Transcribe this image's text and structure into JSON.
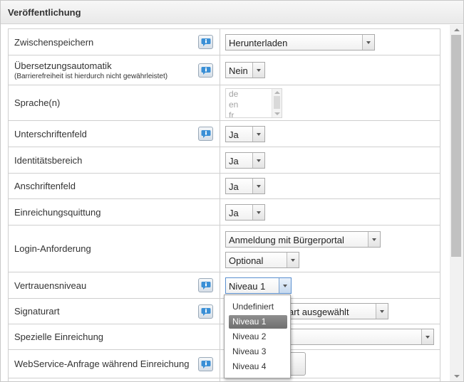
{
  "dialog": {
    "title": "Veröffentlichung"
  },
  "rows": {
    "zwischenspeichern": {
      "label": "Zwischenspeichern",
      "value": "Herunterladen"
    },
    "uebersetzung": {
      "label": "Übersetzungsautomatik",
      "sublabel": "(Barrierefreiheit ist hierdurch nicht gewährleistet)",
      "value": "Nein"
    },
    "sprache": {
      "label": "Sprache(n)",
      "options": [
        "de",
        "en",
        "fr"
      ]
    },
    "unterschriftenfeld": {
      "label": "Unterschriftenfeld",
      "value": "Ja"
    },
    "identitaetsbereich": {
      "label": "Identitätsbereich",
      "value": "Ja"
    },
    "anschriftenfeld": {
      "label": "Anschriftenfeld",
      "value": "Ja"
    },
    "einreichungsquittung": {
      "label": "Einreichungsquittung",
      "value": "Ja"
    },
    "login": {
      "label": "Login-Anforderung",
      "value": "Anmeldung mit Bürgerportal",
      "value2": "Optional"
    },
    "vertrauensniveau": {
      "label": "Vertrauensniveau",
      "value": "Niveau 1"
    },
    "signaturart": {
      "label": "Signaturart",
      "value_partial": "art ausgewählt"
    },
    "spezielle": {
      "label": "Spezielle Einreichung",
      "value": ""
    },
    "webservice": {
      "label": "WebService-Anfrage während Einreichung",
      "button_partial": "n"
    }
  },
  "dropdown": {
    "options": [
      "Undefiniert",
      "Niveau 1",
      "Niveau 2",
      "Niveau 3",
      "Niveau 4"
    ],
    "selected": "Niveau 1"
  }
}
